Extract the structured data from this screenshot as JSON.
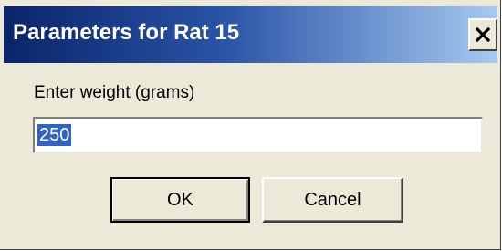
{
  "window": {
    "title": "Parameters for Rat 15",
    "close_icon": "close-x-icon",
    "title_gradient": [
      "#0a246a",
      "#a6caf0"
    ]
  },
  "form": {
    "prompt": "Enter weight (grams)",
    "weight_value": "250",
    "selection_color": "#3163c5"
  },
  "buttons": {
    "ok_label": "OK",
    "cancel_label": "Cancel"
  }
}
